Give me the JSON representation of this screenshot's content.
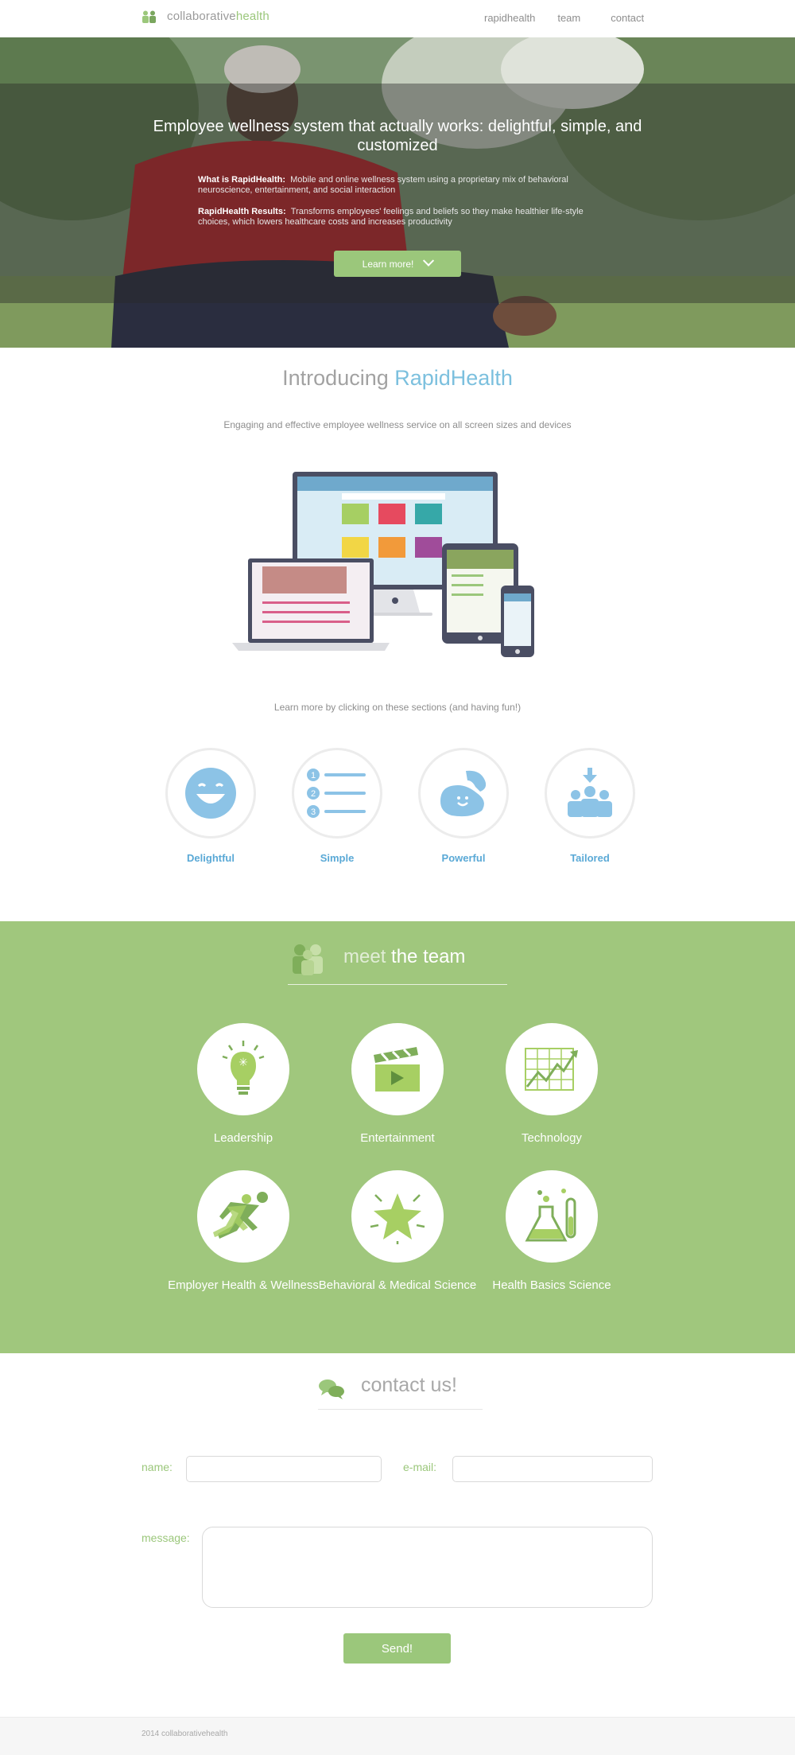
{
  "nav": {
    "logo_text_a": "collaborative",
    "logo_text_b": "health",
    "links": [
      "rapidhealth",
      "team",
      "contact"
    ]
  },
  "hero": {
    "title": "Employee wellness system that actually works: delightful, simple, and customized",
    "line1_label": "What is RapidHealth:",
    "line1_text": "Mobile and online wellness system using a proprietary mix of behavioral neuroscience, entertainment, and social interaction",
    "line2_label": "RapidHealth Results:",
    "line2_text": "Transforms employees' feelings and beliefs so they make healthier life-style choices, which lowers healthcare costs and increases productivity",
    "button": "Learn more!"
  },
  "intro": {
    "title_a": "Introducing ",
    "title_b": "RapidHealth",
    "subtitle": "Engaging and effective employee wellness service on all screen sizes and devices",
    "learn_text": "Learn more by clicking on these sections (and having fun!)",
    "features": [
      "Delightful",
      "Simple",
      "Powerful",
      "Tailored"
    ]
  },
  "team": {
    "title_a": "meet",
    "title_b": "the team",
    "members": [
      "Leadership",
      "Entertainment",
      "Technology",
      "Employer Health & Wellness",
      "Behavioral & Medical Science",
      "Health Basics Science"
    ]
  },
  "contact": {
    "title": "contact us!",
    "name_label": "name:",
    "email_label": "e-mail:",
    "message_label": "message:",
    "name_value": "",
    "email_value": "",
    "message_value": "",
    "send": "Send!"
  },
  "footer": {
    "text": "2014 collaborativehealth"
  },
  "colors": {
    "green": "#9bc77b",
    "team_bg": "#a0c77d",
    "blue": "#7cc0de",
    "feature_blue": "#5aa9d6"
  }
}
